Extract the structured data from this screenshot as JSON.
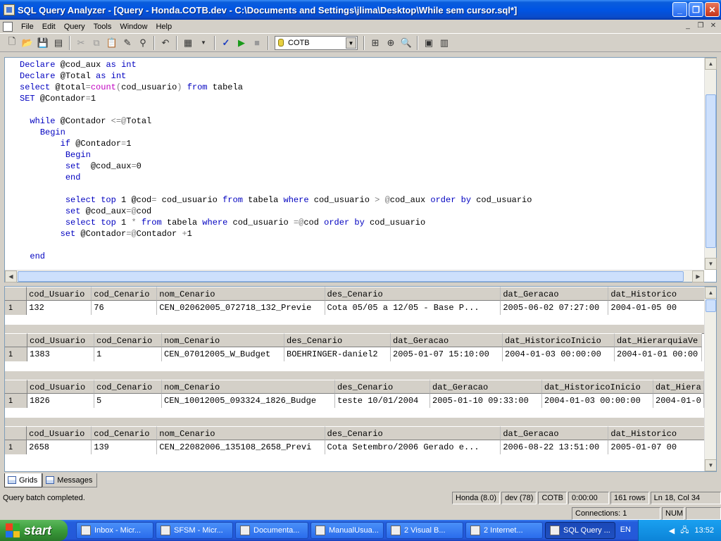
{
  "window": {
    "title": "SQL Query Analyzer - [Query - Honda.COTB.dev - C:\\Documents and Settings\\jlima\\Desktop\\While sem cursor.sql*]",
    "minimize": "_",
    "maximize": "❐",
    "close": "✕"
  },
  "menu": [
    "File",
    "Edit",
    "Query",
    "Tools",
    "Window",
    "Help"
  ],
  "mdi_buttons": [
    "_",
    "❐",
    "✕"
  ],
  "toolbar": {
    "database": "COTB",
    "icons": [
      "new-query-icon",
      "open-icon",
      "save-icon",
      "load-icon",
      "cut-icon",
      "copy-icon",
      "paste-icon",
      "clear-icon",
      "find-icon",
      "undo-icon",
      "results-mode-icon",
      "parse-icon",
      "execute-icon",
      "stop-icon",
      "object-browser-icon",
      "object-search-icon",
      "object-properties-icon",
      "show-results-pane-icon",
      "template-icon"
    ]
  },
  "editor": {
    "lines": [
      "Declare @cod_aux as int",
      "Declare @Total as int",
      "select @total=count(cod_usuario) from tabela",
      "SET @Contador=1",
      "",
      "  while @Contador <=@Total",
      "    Begin",
      "        if @Contador=1",
      "         Begin",
      "         set  @cod_aux=0",
      "         end",
      "",
      "         select top 1 @cod= cod_usuario from tabela where cod_usuario > @cod_aux order by cod_usuario",
      "         set @cod_aux=@cod",
      "         select top 1 * from tabela where cod_usuario =@cod order by cod_usuario",
      "        set @Contador=@Contador +1",
      "",
      "  end"
    ]
  },
  "results": [
    {
      "columns": [
        "cod_Usuario",
        "cod_Cenario",
        "nom_Cenario",
        "des_Cenario",
        "dat_Geracao",
        "dat_Historico"
      ],
      "widths": [
        95,
        96,
        246,
        258,
        158,
        141
      ],
      "row_index": "1",
      "row": [
        "132",
        "76",
        "CEN_02062005_072718_132_Previe",
        "Cota 05/05 a 12/05 - Base P...",
        "2005-06-02 07:27:00",
        "2004-01-05 00"
      ]
    },
    {
      "columns": [
        "cod_Usuario",
        "cod_Cenario",
        "nom_Cenario",
        "des_Cenario",
        "dat_Geracao",
        "dat_HistoricoInicio",
        "dat_HierarquiaVe"
      ],
      "widths": [
        95,
        96,
        174,
        151,
        159,
        159,
        124
      ],
      "row_index": "1",
      "row": [
        "1383",
        "1",
        "CEN_07012005_W_Budget",
        "BOEHRINGER-daniel2",
        "2005-01-07 15:10:00",
        "2004-01-03 00:00:00",
        "2004-01-01 00:00"
      ]
    },
    {
      "columns": [
        "cod_Usuario",
        "cod_Cenario",
        "nom_Cenario",
        "des_Cenario",
        "dat_Geracao",
        "dat_HistoricoInicio",
        "dat_Hiera"
      ],
      "widths": [
        95,
        96,
        246,
        135,
        159,
        158,
        72
      ],
      "row_index": "1",
      "row": [
        "1826",
        "5",
        "CEN_10012005_093324_1826_Budge",
        "teste 10/01/2004",
        "2005-01-10 09:33:00",
        "2004-01-03 00:00:00",
        "2004-01-0"
      ]
    },
    {
      "columns": [
        "cod_Usuario",
        "cod_Cenario",
        "nom_Cenario",
        "des_Cenario",
        "dat_Geracao",
        "dat_Historico"
      ],
      "widths": [
        95,
        96,
        246,
        258,
        158,
        141
      ],
      "row_index": "1",
      "row": [
        "2658",
        "139",
        "CEN_22082006_135108_2658_Previ",
        "Cota Setembro/2006 Gerado e...",
        "2006-08-22 13:51:00",
        "2005-01-07 00"
      ]
    }
  ],
  "tabs": [
    "Grids",
    "Messages"
  ],
  "status": {
    "message": "Query batch completed.",
    "server": "Honda (8.0)",
    "user": "dev (78)",
    "database": "COTB",
    "time": "0:00:00",
    "rows": "161 rows",
    "position": "Ln 18, Col 34",
    "connections": "Connections: 1",
    "num": "NUM"
  },
  "taskbar": {
    "start": "start",
    "tasks": [
      "Inbox - Micr...",
      "SFSM - Micr...",
      "Documenta...",
      "ManualUsua...",
      "2 Visual B...",
      "2 Internet...",
      "SQL Query ..."
    ],
    "lang": "EN",
    "clock": "13:52"
  }
}
